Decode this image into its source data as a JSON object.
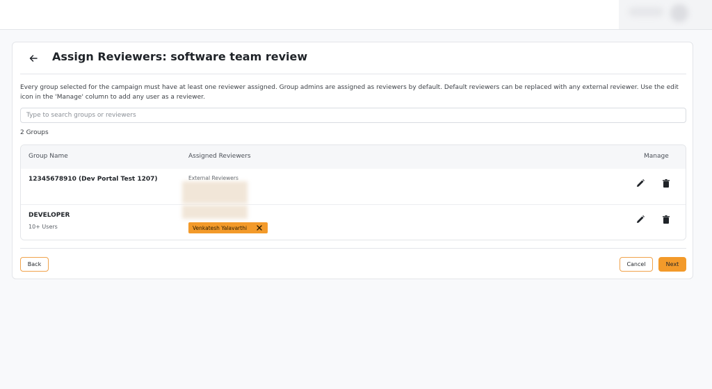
{
  "header": {
    "title": "Assign Reviewers: software team review",
    "back_icon": "arrow-left-icon"
  },
  "description": "Every group selected for the campaign must have at least one reviewer assigned. Group admins are assigned as reviewers by default. Default reviewers can be replaced with any external reviewer. Use the edit icon in the 'Manage' column to add any user as a reviewer.",
  "search": {
    "placeholder": "Type to search groups or reviewers",
    "value": ""
  },
  "group_count": "2 Groups",
  "table": {
    "columns": [
      "Group Name",
      "Assigned Reviewers",
      "Manage"
    ],
    "rows": [
      {
        "group_name": "12345678910 (Dev Portal Test 1207)",
        "subtitle": "",
        "reviewer_label": "External Reviewers",
        "reviewer_chip": ""
      },
      {
        "group_name": "DEVELOPER",
        "subtitle": "10+ Users",
        "reviewer_label": "",
        "reviewer_chip": "Venkatesh Yalavarthi"
      }
    ],
    "manage_icons": [
      "pencil-icon",
      "trash-icon"
    ]
  },
  "footer": {
    "back_label": "Back",
    "cancel_label": "Cancel",
    "next_label": "Next"
  },
  "colors": {
    "accent": "#f39a2a",
    "accent_border": "#f0a24a"
  }
}
